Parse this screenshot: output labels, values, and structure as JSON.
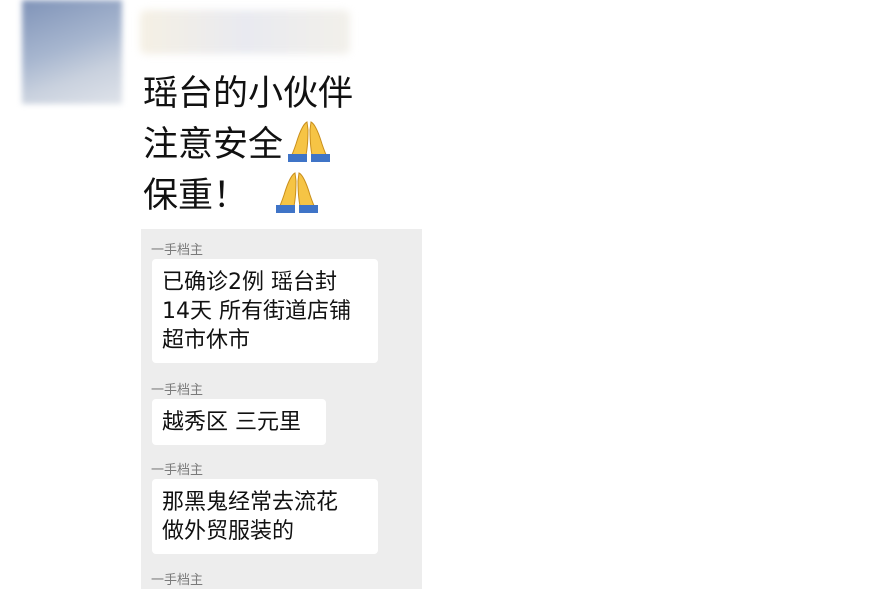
{
  "post": {
    "lines": [
      "瑶台的小伙伴",
      "注意安全",
      "保重！"
    ],
    "emoji": "pray-emoji"
  },
  "forwarded_chat": {
    "messages": [
      {
        "sender": "一手档主",
        "lines": [
          "已确诊2例 瑶台封",
          "14天 所有街道店铺",
          "超市休市"
        ]
      },
      {
        "sender": "一手档主",
        "lines": [
          "越秀区 三元里"
        ]
      },
      {
        "sender": "一手档主",
        "lines": [
          "那黑鬼经常去流花",
          "做外贸服装的"
        ]
      },
      {
        "sender": "一手档主",
        "lines": []
      }
    ]
  }
}
